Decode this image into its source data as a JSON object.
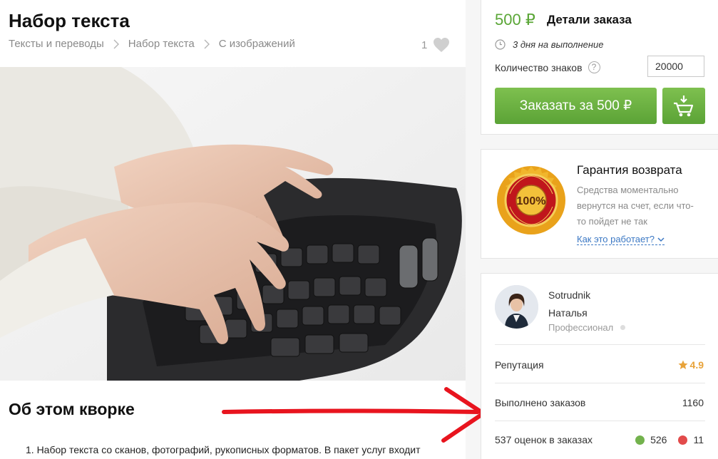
{
  "header": {
    "title": "Набор текста",
    "breadcrumbs": [
      "Тексты и переводы",
      "Набор текста",
      "С изображений"
    ],
    "likes": "1"
  },
  "about": {
    "title": "Об этом кворке",
    "item_1": "1. Набор текста со сканов, фотографий, рукописных форматов. В пакет услуг входит"
  },
  "order": {
    "price": "500 ₽",
    "title": "Детали заказа",
    "deadline": "3 дня на выполнение",
    "quantity_label": "Количество знаков",
    "quantity_value": "20000",
    "order_button": "Заказать за 500 ₽"
  },
  "guarantee": {
    "title": "Гарантия возврата",
    "text": "Средства моментально вернутся на счет, если что-то пойдет не так",
    "link": "Как это работает?"
  },
  "seller": {
    "username": "Sotrudnik",
    "name": "Наталья",
    "level": "Профессионал",
    "reputation_label": "Репутация",
    "reputation_value": "4.9",
    "orders_label": "Выполнено заказов",
    "orders_value": "1160",
    "reviews_label": "537 оценок в заказах",
    "positive": "526",
    "negative": "11"
  },
  "colors": {
    "accent_green": "#5ba336",
    "link_blue": "#3b78c4",
    "star": "#e8a33a",
    "arrow_red": "#e8141e"
  }
}
